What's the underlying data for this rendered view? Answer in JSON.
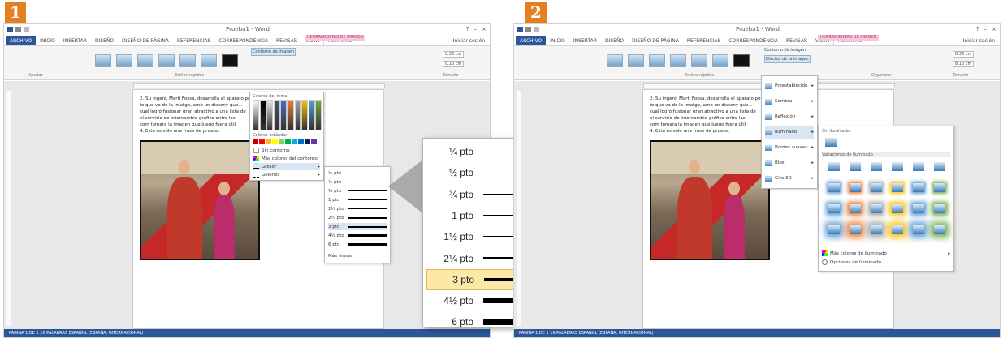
{
  "badges": {
    "one": "1",
    "two": "2"
  },
  "window": {
    "title": "Prueba1 - Word",
    "ribbon_tabs": [
      "ARCHIVO",
      "INICIO",
      "INSERTAR",
      "DISEÑO",
      "DISEÑO DE PÁGINA",
      "REFERENCIAS",
      "CORRESPONDENCIA",
      "REVISAR",
      "VISTA",
      "FORMATO"
    ],
    "context_group": "HERRAMIENTAS DE IMAGEN",
    "account": "Iniciar sesión"
  },
  "ribbon": {
    "quick_styles": "Estilos rápidos",
    "arrange": "Organizar",
    "size": "Tamaño",
    "adjust": "Ajustar",
    "border_button": "Contorno de imagen",
    "effects_button": "Efectos de la imagen",
    "width_value": "8,36 cm",
    "height_value": "8,16 cm"
  },
  "document": {
    "lines": [
      "2. Su ingeni, Martí Fossa, desarrolla el aparato per a la",
      "    fo que va de la imatge, amb un disseny que...",
      "    cual logró fusionar gran atractivo a una lista de",
      "    el servicio de intercambio gráfico entre las",
      "    com tomara la imagen que luego fuera útil",
      "4. Esta es sólo una frase de prueba."
    ]
  },
  "statusbar": {
    "left": "PÁGINA 1 DE 1    16 PALABRAS    ESPAÑOL (ESPAÑA, INTERNACIONAL)"
  },
  "border_menu": {
    "theme_colors_label": "Colores del tema",
    "standard_colors_label": "Colores estándar",
    "no_outline": "Sin contorno",
    "more_colors": "Más colores del contorno",
    "weight": "Grosor",
    "dashes": "Guiones",
    "weights_small": [
      "¼ pto",
      "½ pto",
      "¾ pto",
      "1 pto",
      "1½ pto",
      "2¼ pto",
      "3 pto",
      "4½ pto",
      "6 pto"
    ],
    "more_lines": "Más líneas"
  },
  "effects_menu": {
    "items": [
      "Preestablecido",
      "Sombra",
      "Reflexión",
      "Iluminado",
      "Bordes suaves",
      "Bisel",
      "Giro 3D"
    ],
    "glow_none_label": "Sin iluminado",
    "glow_variations_label": "Variaciones de iluminado",
    "more_glow_colors": "Más colores de iluminado",
    "glow_options": "Opciones de iluminado"
  },
  "zoom": {
    "weights": [
      {
        "label": "¼ pto",
        "weight": 1
      },
      {
        "label": "½ pto",
        "weight": 1
      },
      {
        "label": "¾ pto",
        "weight": 1
      },
      {
        "label": "1 pto",
        "weight": 2
      },
      {
        "label": "1½ pto",
        "weight": 2
      },
      {
        "label": "2¼ pto",
        "weight": 3
      },
      {
        "label": "3 pto",
        "weight": 4
      },
      {
        "label": "4½ pto",
        "weight": 6
      },
      {
        "label": "6 pto",
        "weight": 8
      }
    ],
    "selected_index": 6
  },
  "colors": {
    "accent": "#2b579a",
    "context_tab": "#c2306f",
    "badge": "#e67e22",
    "selected_row": "#fce9a8"
  }
}
